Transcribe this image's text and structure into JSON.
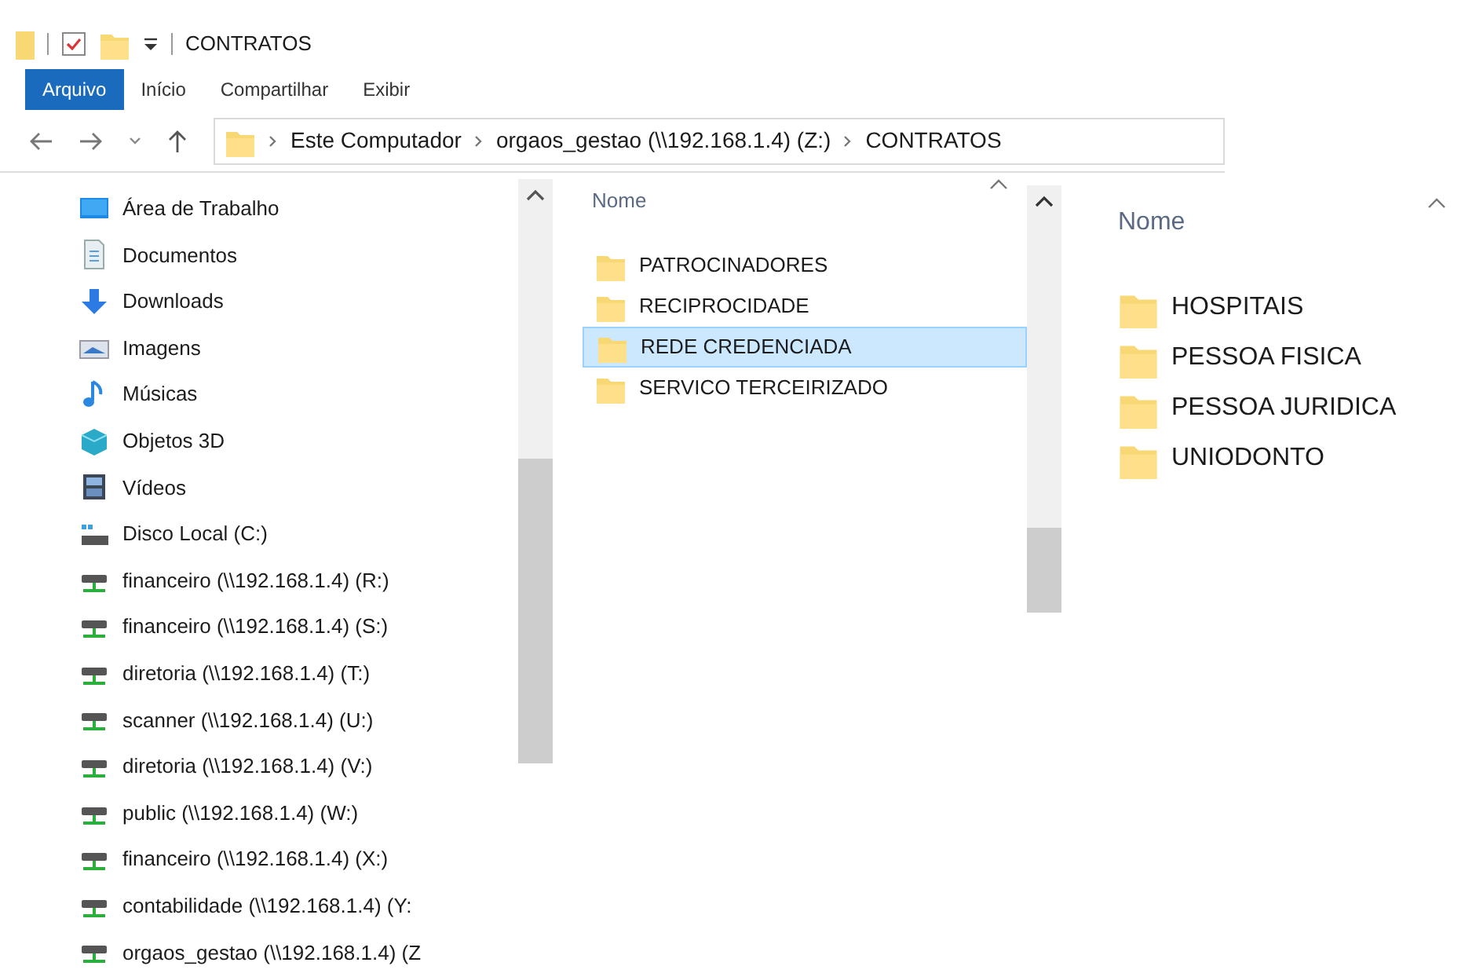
{
  "window": {
    "title": "CONTRATOS"
  },
  "ribbon_tabs": [
    {
      "label": "Arquivo",
      "selected": true
    },
    {
      "label": "Início",
      "selected": false
    },
    {
      "label": "Compartilhar",
      "selected": false
    },
    {
      "label": "Exibir",
      "selected": false
    }
  ],
  "address_bar": {
    "segments": [
      "Este Computador",
      "orgaos_gestao (\\\\192.168.1.4) (Z:)",
      "CONTRATOS"
    ]
  },
  "navigation": {
    "items": [
      {
        "label": "Área de Trabalho",
        "kind": "desktop"
      },
      {
        "label": "Documentos",
        "kind": "documents"
      },
      {
        "label": "Downloads",
        "kind": "downloads"
      },
      {
        "label": "Imagens",
        "kind": "pictures"
      },
      {
        "label": "Músicas",
        "kind": "music"
      },
      {
        "label": "Objetos 3D",
        "kind": "objects"
      },
      {
        "label": "Vídeos",
        "kind": "videos"
      },
      {
        "label": "Disco Local (C:)",
        "kind": "disk"
      },
      {
        "label": "financeiro (\\\\192.168.1.4) (R:)",
        "kind": "network"
      },
      {
        "label": "financeiro (\\\\192.168.1.4) (S:)",
        "kind": "network"
      },
      {
        "label": "diretoria (\\\\192.168.1.4) (T:)",
        "kind": "network"
      },
      {
        "label": "scanner (\\\\192.168.1.4) (U:)",
        "kind": "network"
      },
      {
        "label": "diretoria (\\\\192.168.1.4) (V:)",
        "kind": "network"
      },
      {
        "label": "public (\\\\192.168.1.4) (W:)",
        "kind": "network"
      },
      {
        "label": "financeiro (\\\\192.168.1.4) (X:)",
        "kind": "network"
      },
      {
        "label": "contabilidade (\\\\192.168.1.4) (Y:",
        "kind": "network"
      },
      {
        "label": "orgaos_gestao (\\\\192.168.1.4) (Z",
        "kind": "network"
      }
    ]
  },
  "file_list": {
    "column_header": "Nome",
    "items": [
      {
        "name": "PATROCINADORES",
        "selected": false
      },
      {
        "name": "RECIPROCIDADE",
        "selected": false
      },
      {
        "name": "REDE CREDENCIADA",
        "selected": true
      },
      {
        "name": "SERVICO TERCEIRIZADO",
        "selected": false
      }
    ]
  },
  "subfolder_list": {
    "column_header": "Nome",
    "items": [
      {
        "name": "HOSPITAIS",
        "selected": false
      },
      {
        "name": "PESSOA FISICA",
        "selected": false
      },
      {
        "name": "PESSOA JURIDICA",
        "selected": false
      },
      {
        "name": "UNIODONTO",
        "selected": false
      }
    ]
  }
}
